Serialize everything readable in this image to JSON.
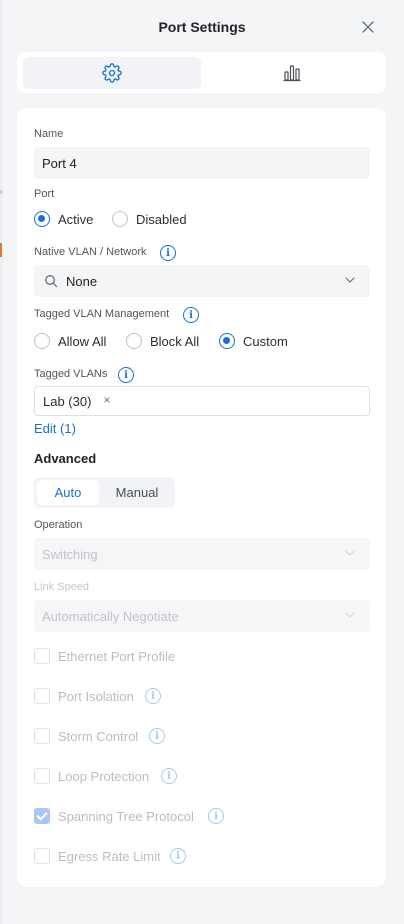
{
  "header": {
    "title": "Port Settings"
  },
  "tabs": [
    {
      "icon": "gear-icon",
      "active": true
    },
    {
      "icon": "bar-chart-icon",
      "active": false
    }
  ],
  "name_field": {
    "label": "Name",
    "value": "Port 4"
  },
  "port": {
    "label": "Port",
    "options": [
      "Active",
      "Disabled"
    ],
    "selected": "Active"
  },
  "native_vlan": {
    "label": "Native VLAN / Network",
    "value": "None"
  },
  "tagged_mgmt": {
    "label": "Tagged VLAN Management",
    "options": [
      "Allow All",
      "Block All",
      "Custom"
    ],
    "selected": "Custom"
  },
  "tagged_vlans": {
    "label": "Tagged VLANs",
    "chips": [
      "Lab (30)"
    ],
    "edit_link": "Edit (1)"
  },
  "advanced": {
    "title": "Advanced",
    "modes": [
      "Auto",
      "Manual"
    ],
    "selected_mode": "Auto",
    "operation": {
      "label": "Operation",
      "value": "Switching"
    },
    "link_speed": {
      "label": "Link Speed",
      "value": "Automatically Negotiate"
    },
    "options": [
      {
        "label": "Ethernet Port Profile",
        "checked": false,
        "info": false
      },
      {
        "label": "Port Isolation",
        "checked": false,
        "info": true
      },
      {
        "label": "Storm Control",
        "checked": false,
        "info": true
      },
      {
        "label": "Loop Protection",
        "checked": false,
        "info": true
      },
      {
        "label": "Spanning Tree Protocol",
        "checked": true,
        "info": true
      },
      {
        "label": "Egress Rate Limit",
        "checked": false,
        "info": true
      }
    ]
  },
  "colors": {
    "accent": "#1b6fd1",
    "disabled_text": "#b9bdc3",
    "background": "#f4f5f7"
  }
}
